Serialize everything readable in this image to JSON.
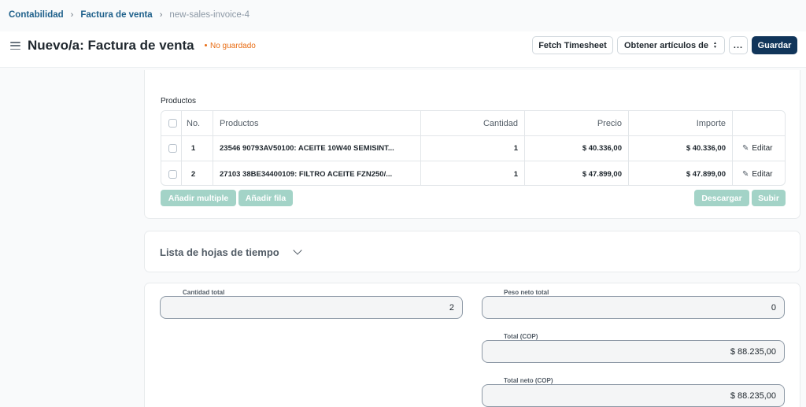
{
  "breadcrumb": {
    "items": [
      "Contabilidad",
      "Factura de venta"
    ],
    "current": "new-sales-invoice-4"
  },
  "header": {
    "title": "Nuevo/a: Factura de venta",
    "status": "No guardado",
    "buttons": {
      "fetch_timesheet": "Fetch Timesheet",
      "get_items": "Obtener artículos de",
      "more": "...",
      "save": "Guardar"
    }
  },
  "products": {
    "section_label": "Productos",
    "columns": [
      "No.",
      "Productos",
      "Cantidad",
      "Precio",
      "Importe"
    ],
    "rows": [
      {
        "no": "1",
        "product": "23546 90793AV50100: ACEITE 10W40 SEMISINT...",
        "qty": "1",
        "price": "$ 40.336,00",
        "amount": "$ 40.336,00",
        "edit": "Editar"
      },
      {
        "no": "2",
        "product": "27103 38BE34400109: FILTRO ACEITE FZN250/...",
        "qty": "1",
        "price": "$ 47.899,00",
        "amount": "$ 47.899,00",
        "edit": "Editar"
      }
    ],
    "buttons": {
      "add_multiple": "Añadir multiple",
      "add_row": "Añadir fila",
      "download": "Descargar",
      "upload": "Subir"
    }
  },
  "timesheet": {
    "title": "Lista de hojas de tiempo"
  },
  "totals": {
    "total_qty_label": "Cantidad total",
    "total_qty": "2",
    "net_weight_label": "Peso neto total",
    "net_weight": "0",
    "total_label": "Total (COP)",
    "total": "$ 88.235,00",
    "net_total_label": "Total neto (COP)",
    "net_total": "$ 88.235,00"
  },
  "colors": {
    "primary": "#11355a",
    "link": "#1d5f8a",
    "status": "#e86c13",
    "disabled_button": "#a3d3c7"
  }
}
